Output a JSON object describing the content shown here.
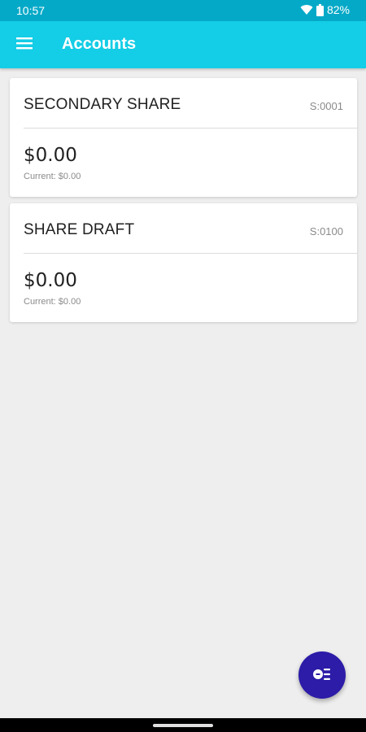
{
  "status_bar": {
    "time": "10:57",
    "battery": "82%",
    "icons": [
      "wifi-icon",
      "battery-icon"
    ]
  },
  "app_bar": {
    "title": "Accounts",
    "menu_icon": "menu-icon"
  },
  "accounts": [
    {
      "name": "SECONDARY SHARE",
      "id": "S:0001",
      "balance": "$0.00",
      "current": "Current: $0.00"
    },
    {
      "name": "SHARE DRAFT",
      "id": "S:0100",
      "balance": "$0.00",
      "current": "Current: $0.00"
    }
  ],
  "fab": {
    "icon": "transfer-money-icon"
  },
  "colors": {
    "status_bar": "#05a9c8",
    "app_bar": "#14cde6",
    "background": "#eeeeee",
    "fab": "#2c1ca8"
  }
}
